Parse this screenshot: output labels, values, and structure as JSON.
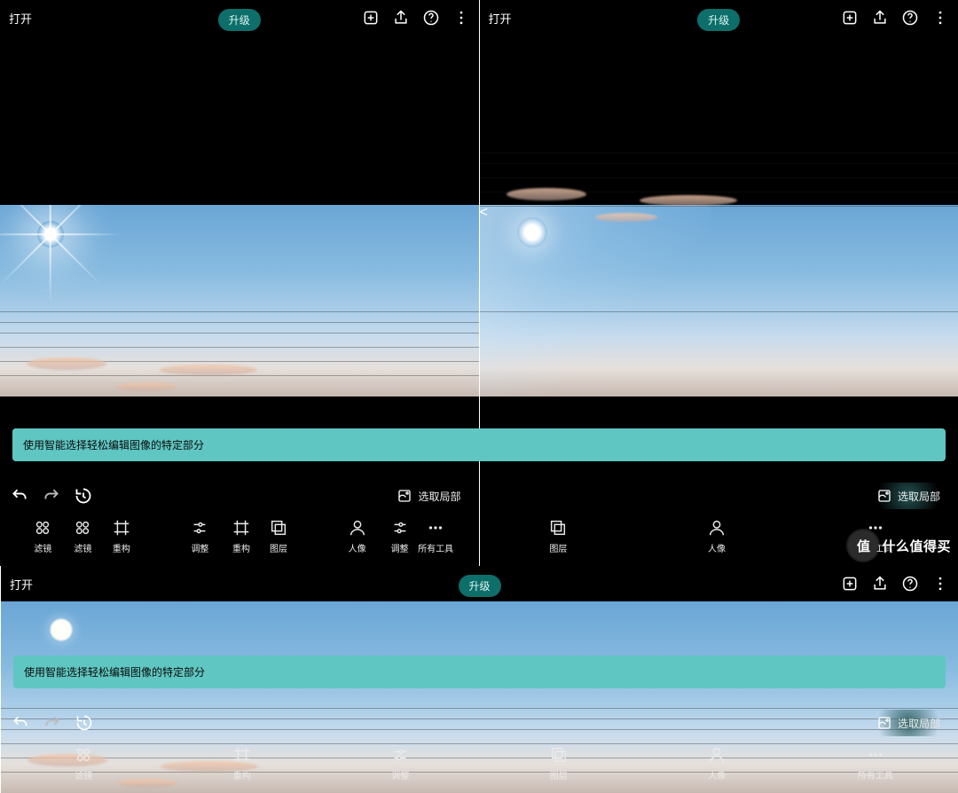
{
  "header": {
    "open_label": "打开",
    "upgrade_label": "升级"
  },
  "tip_text": "使用智能选择轻松编辑图像的特定部分",
  "select_local_label": "选取局部",
  "tools": {
    "filter": "滤镜",
    "recompose": "重构",
    "adjust": "调整",
    "layers": "图层",
    "portrait": "人像",
    "all": "所有工具"
  },
  "watermark": {
    "badge": "值",
    "text": "什么值得买"
  },
  "icons": {
    "add": "add-icon",
    "share": "share-icon",
    "help": "help-icon",
    "more": "more-icon",
    "undo": "undo-icon",
    "redo": "redo-icon",
    "history": "history-icon",
    "selectlocal": "select-local-icon"
  }
}
